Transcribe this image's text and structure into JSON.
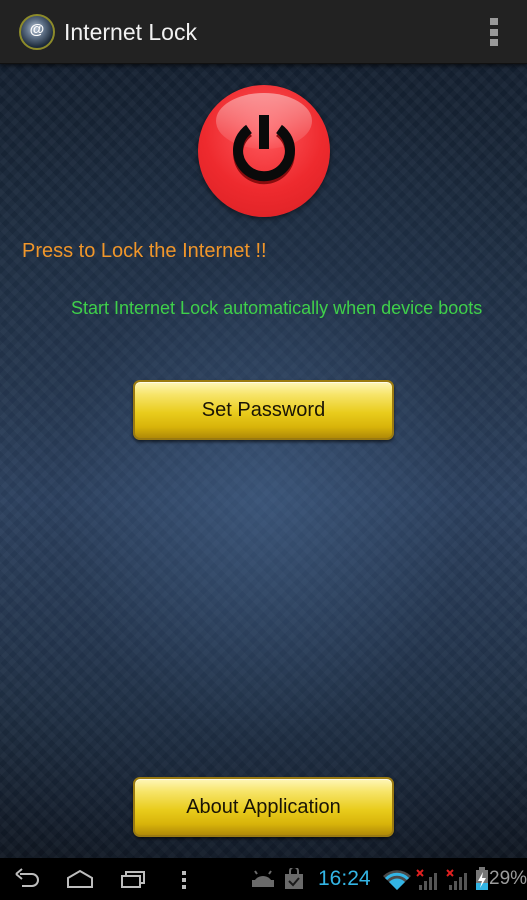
{
  "action_bar": {
    "app_icon": "app-logo-icon",
    "app_icon_glyph": "@",
    "title": "Internet Lock",
    "overflow_icon": "overflow-menu-icon"
  },
  "main": {
    "power_button_icon": "power-icon",
    "lock_label": "Press to Lock the Internet !!",
    "autostart_label": "Start Internet Lock automatically when device boots",
    "set_password_label": "Set Password",
    "about_label": "About Application"
  },
  "colors": {
    "lock_label": "#f0962a",
    "autostart_label": "#3fd04a",
    "power_button": "#ee2a2e",
    "gold_button": "#e9cc1c",
    "clock": "#33b5e5"
  },
  "system_bar": {
    "nav": [
      "back-icon",
      "home-icon",
      "recent-apps-icon",
      "menu-icon"
    ],
    "notifications": [
      "android-debug-icon",
      "play-store-update-icon"
    ],
    "time": "16:24",
    "status_icons": [
      "wifi-icon",
      "signal-no-sim-icon",
      "signal-no-sim-icon",
      "battery-charging-icon"
    ],
    "battery_percent": "29%"
  }
}
